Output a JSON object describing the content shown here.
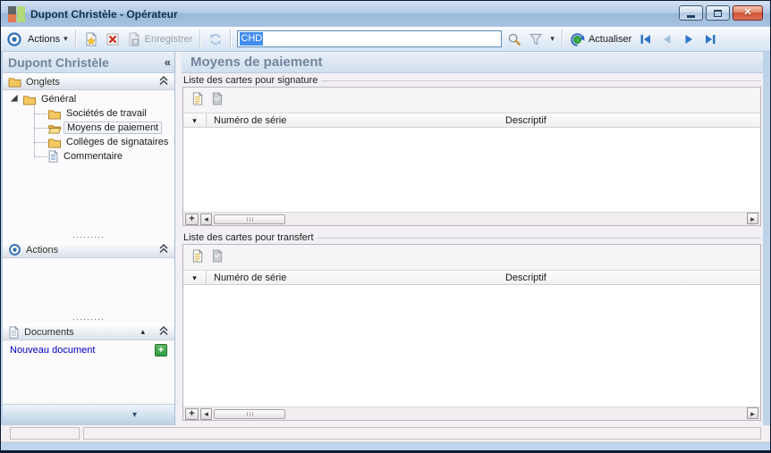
{
  "window": {
    "title": "Dupont Christèle -  Opérateur"
  },
  "toolbar": {
    "actions_label": "Actions",
    "save_label": "Enregistrer",
    "search_value": "CHD",
    "refresh_label": "Actualiser"
  },
  "sidebar": {
    "header_title": "Dupont Christèle",
    "collapse_glyph": "«",
    "onglets_title": "Onglets",
    "actions_title": "Actions",
    "documents_title": "Documents",
    "new_document_label": "Nouveau document",
    "tree": {
      "root_label": "Général",
      "items": [
        {
          "label": "Sociétés de travail",
          "selected": false
        },
        {
          "label": "Moyens de paiement",
          "selected": true
        },
        {
          "label": "Collèges de signataires",
          "selected": false
        },
        {
          "label": "Commentaire",
          "selected": false
        }
      ]
    }
  },
  "main": {
    "page_title": "Moyens de paiement",
    "groups": [
      {
        "label": "Liste des cartes pour signature",
        "columns": [
          "Numéro de série",
          "Descriptif"
        ]
      },
      {
        "label": "Liste des cartes pour transfert",
        "columns": [
          "Numéro de série",
          "Descriptif"
        ]
      }
    ]
  },
  "icons": {
    "caret_down": "▾",
    "caret_up": "▴",
    "plus": "+",
    "scroll_left": "◂",
    "scroll_right": "▸",
    "close": "✕",
    "splitter_dots": "·········"
  },
  "colors": {
    "selection_blue": "#418cf0",
    "link_blue": "#0000c8",
    "plus_green": "#2e9e44",
    "close_red": "#d0543a",
    "folder_yellow": "#f3c860",
    "header_text_gray": "#75849c"
  }
}
